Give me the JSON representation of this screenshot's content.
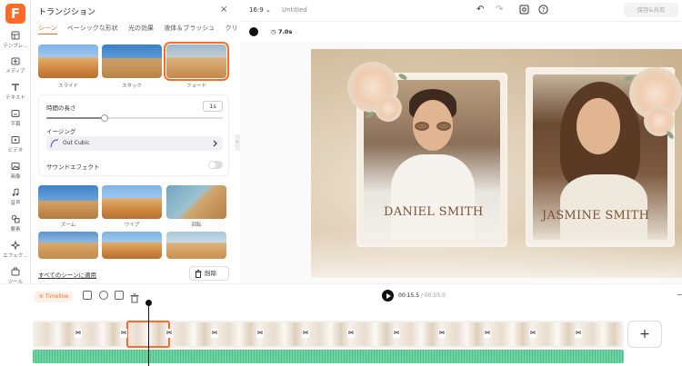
{
  "app": {
    "logo_letter": "F"
  },
  "rail": {
    "items": [
      {
        "label": "テンプレ…",
        "icon": "template-icon"
      },
      {
        "label": "メディア",
        "icon": "media-icon"
      },
      {
        "label": "テキスト",
        "icon": "text-icon"
      },
      {
        "label": "字幕",
        "icon": "subtitle-icon"
      },
      {
        "label": "ビデオ",
        "icon": "video-icon"
      },
      {
        "label": "画像",
        "icon": "image-icon"
      },
      {
        "label": "音声",
        "icon": "audio-icon"
      },
      {
        "label": "要素",
        "icon": "elements-icon"
      },
      {
        "label": "エフェク…",
        "icon": "effects-icon"
      },
      {
        "label": "ツール",
        "icon": "tools-icon"
      }
    ]
  },
  "panel": {
    "title": "トランジション",
    "tabs": [
      "シーン",
      "ベーシックな形状",
      "光の効果",
      "液体＆ブラッシュ",
      "クリ"
    ],
    "active_tab": "シーン",
    "thumbs_top": [
      {
        "label": "スライド"
      },
      {
        "label": "スタック"
      },
      {
        "label": "フェード",
        "selected": true
      }
    ],
    "thumbs_bottom": [
      {
        "label": "ズーム"
      },
      {
        "label": "ワイプ"
      },
      {
        "label": "回転"
      }
    ],
    "settings": {
      "duration_label": "時間の長さ",
      "duration_value": "1s",
      "duration_fraction": 0.33,
      "easing_label": "イージング",
      "easing_value": "Out Cubic",
      "sound_label": "サウンドエフェクト",
      "sound_on": false
    },
    "apply_all": "すべてのシーンに適用",
    "delete": "削除"
  },
  "topbar": {
    "ratio": "16:9",
    "title": "Untitled",
    "export": "保存&共有"
  },
  "options": {
    "duration": "7.0s",
    "color": "#111111"
  },
  "stage": {
    "name_left": "DANIEL SMITH",
    "name_right": "JASMINE SMITH"
  },
  "playback": {
    "timeline_label": "Timeline",
    "current": "00:15.5",
    "total": "/ 00:05.0"
  },
  "timeline": {
    "add_label": "+"
  },
  "colors": {
    "accent": "#ff6a2a",
    "audio": "#6fd3a4"
  }
}
